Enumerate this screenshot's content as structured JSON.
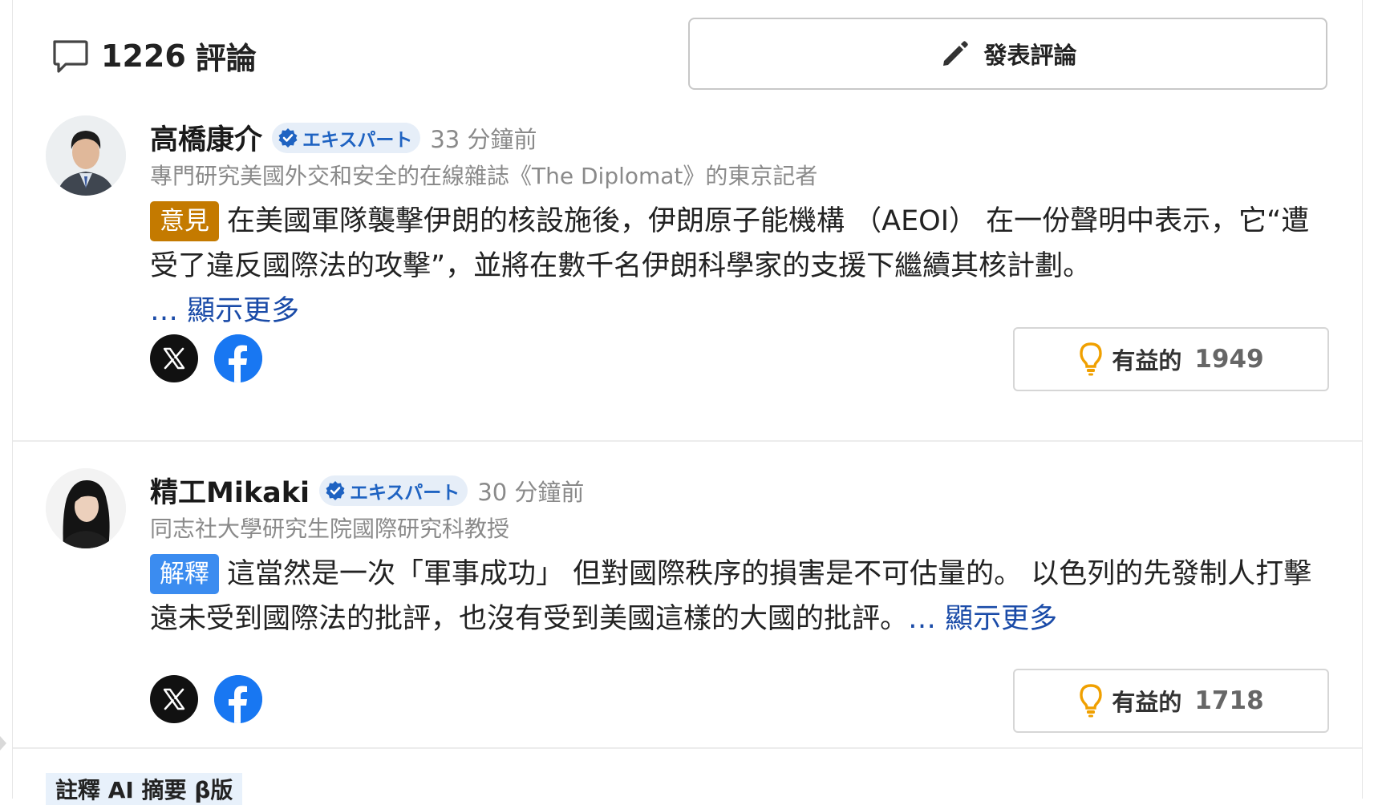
{
  "header": {
    "comment_count": "1226",
    "comment_label": "評論",
    "post_button_label": "發表評論"
  },
  "comments": [
    {
      "author": "高橋康介",
      "badge": "エキスパート",
      "time": "33 分鐘前",
      "role": "專門研究美國外交和安全的在線雜誌《The Diplomat》的東京記者",
      "tag": "意見",
      "text": "在美國軍隊襲擊伊朗的核設施後，伊朗原子能機構 （AEOI） 在一份聲明中表示，它“遭受了違反國際法的攻擊”，並將在數千名伊朗科學家的支援下繼續其核計劃。",
      "more": "… 顯示更多",
      "helpful_label": "有益的",
      "helpful_count": "1949"
    },
    {
      "author": "精工Mikaki",
      "badge": "エキスパート",
      "time": "30 分鐘前",
      "role": "同志社大學研究生院國際研究科教授",
      "tag": "解釋",
      "text": "這當然是一次「軍事成功」 但對國際秩序的損害是不可估量的。 以色列的先發制人打擊遠未受到國際法的批評，也沒有受到美國這樣的大國的批評。",
      "more": "… 顯示更多",
      "helpful_label": "有益的",
      "helpful_count": "1718"
    }
  ],
  "ai_summary": {
    "label": "註釋 AI 摘要 β版"
  },
  "colors": {
    "opinion_tag": "#c47a00",
    "explain_tag": "#3b8cf0",
    "link": "#1a4ba8",
    "badge_text": "#1f63c2",
    "helpful_icon": "#f0a000",
    "facebook": "#1877f2"
  },
  "icons": {
    "comment": "speech-bubble-icon",
    "post": "pencil-icon",
    "badge": "verified-check-icon",
    "share_x": "x-logo-icon",
    "share_fb": "facebook-logo-icon",
    "helpful": "lightbulb-icon"
  }
}
